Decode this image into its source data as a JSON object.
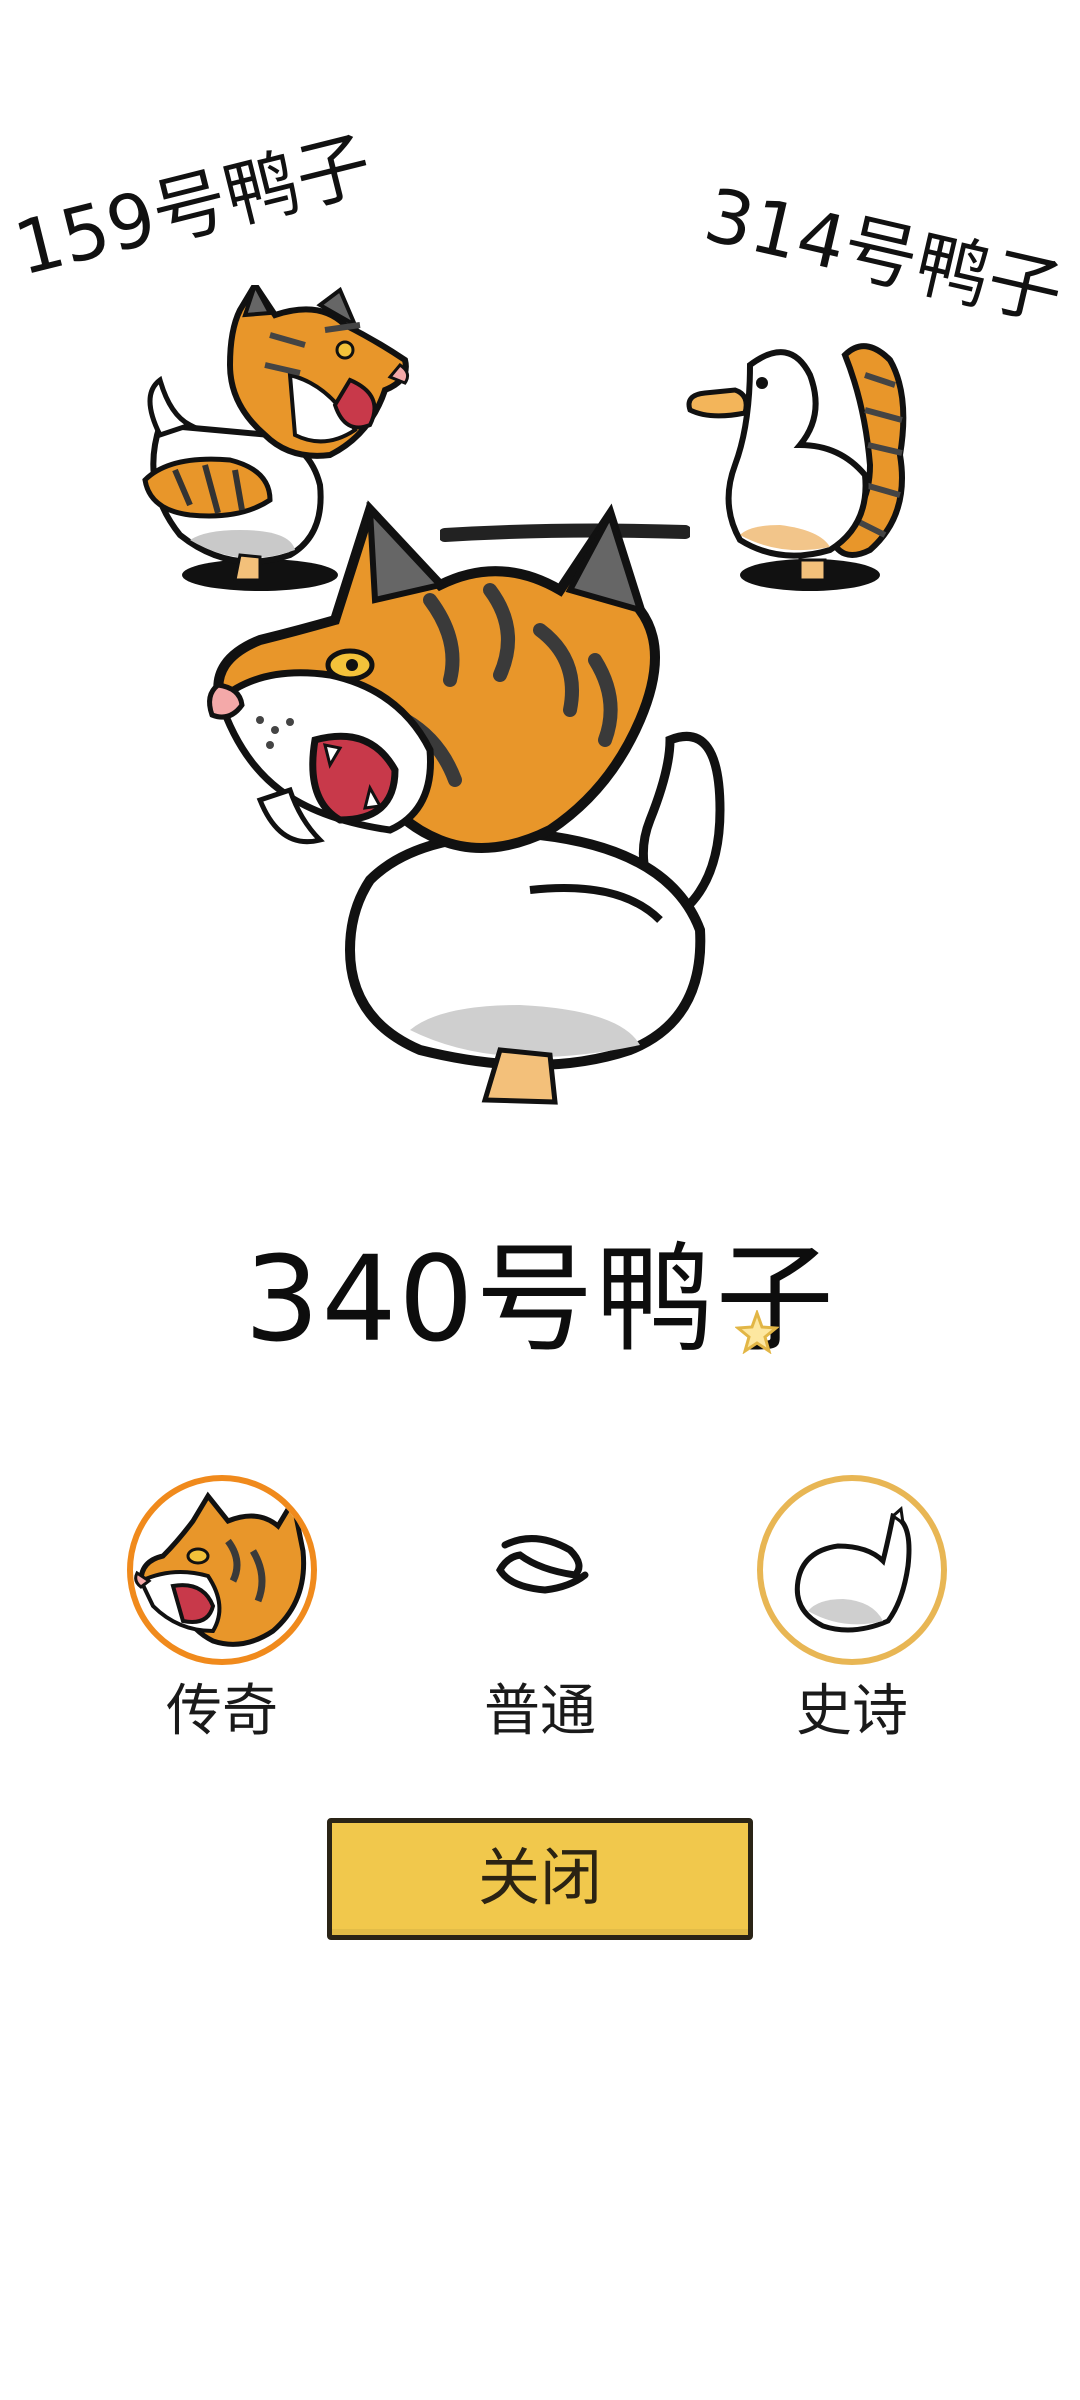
{
  "duck_left": {
    "name": "159号鸭子"
  },
  "duck_right": {
    "name": "314号鸭子"
  },
  "main": {
    "title": "340号鸭子"
  },
  "options": [
    {
      "label": "传奇",
      "rarity": "legendary",
      "icon": "tiger-duck-icon",
      "ring_color": "#f08a1c"
    },
    {
      "label": "普通",
      "rarity": "common",
      "icon": "duck-mouth-icon",
      "ring_color": ""
    },
    {
      "label": "史诗",
      "rarity": "epic",
      "icon": "duck-body-icon",
      "ring_color": "#e8b654"
    }
  ],
  "close_button": {
    "label": "关闭"
  },
  "colors": {
    "tiger_orange": "#e8962a",
    "stripe_grey": "#555555",
    "button_yellow": "#f1c84c",
    "legend_ring": "#f08a1c",
    "epic_ring": "#e8b654"
  }
}
